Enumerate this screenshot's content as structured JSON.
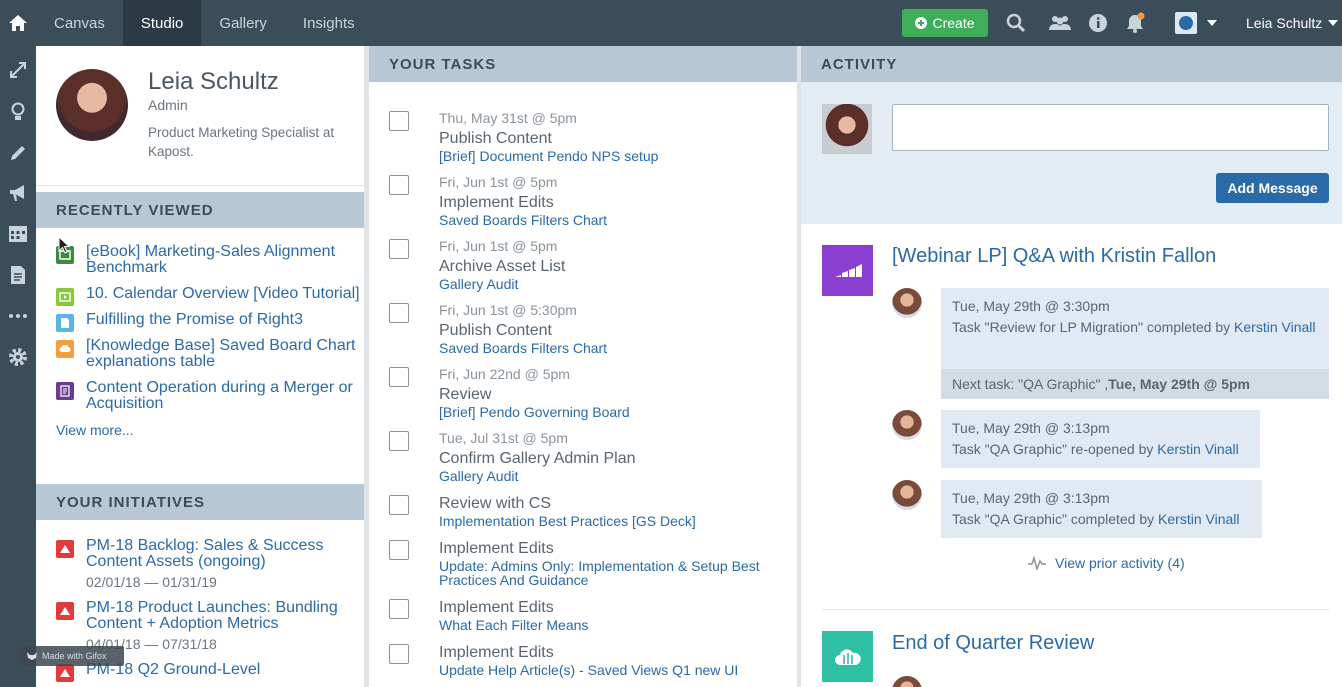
{
  "nav": {
    "tabs": [
      {
        "label": "Canvas"
      },
      {
        "label": "Studio"
      },
      {
        "label": "Gallery"
      },
      {
        "label": "Insights"
      }
    ],
    "create_label": "Create",
    "user_name": "Leia Schultz"
  },
  "profile": {
    "name": "Leia Schultz",
    "role": "Admin",
    "description": "Product Marketing Specialist at Kapost."
  },
  "recently_viewed": {
    "heading": "RECENTLY VIEWED",
    "items": [
      {
        "label": "[eBook] Marketing-Sales Alignment Benchmark",
        "color": "#3d8b3d"
      },
      {
        "label": "10. Calendar Overview [Video Tutorial]",
        "color": "#8cc63f"
      },
      {
        "label": "Fulfilling the Promise of Right3",
        "color": "#5bb5e0"
      },
      {
        "label": "[Knowledge Base] Saved Board Chart explanations table",
        "color": "#f0a040"
      },
      {
        "label": "Content Operation during a Merger or Acquisition",
        "color": "#6a3d8e"
      }
    ],
    "view_more": "View more..."
  },
  "initiatives": {
    "heading": "YOUR INITIATIVES",
    "items": [
      {
        "title": "PM-18 Backlog: Sales & Success Content Assets (ongoing)",
        "dates": "02/01/18 — 01/31/19"
      },
      {
        "title": "PM-18 Product Launches: Bundling Content + Adoption Metrics",
        "dates": "04/01/18 — 07/31/18"
      },
      {
        "title": "PM-18 Q2 Ground-Level",
        "dates": ""
      }
    ]
  },
  "tasks": {
    "heading": "YOUR TASKS",
    "items": [
      {
        "date": "Thu, May 31st @ 5pm",
        "title": "Publish Content",
        "link": "[Brief] Document Pendo NPS setup"
      },
      {
        "date": "Fri, Jun 1st @ 5pm",
        "title": "Implement Edits",
        "link": "Saved Boards Filters Chart"
      },
      {
        "date": "Fri, Jun 1st @ 5pm",
        "title": "Archive Asset List",
        "link": "Gallery Audit"
      },
      {
        "date": "Fri, Jun 1st @ 5:30pm",
        "title": "Publish Content",
        "link": "Saved Boards Filters Chart"
      },
      {
        "date": "Fri, Jun 22nd @ 5pm",
        "title": "Review",
        "link": "[Brief] Pendo Governing Board"
      },
      {
        "date": "Tue, Jul 31st @ 5pm",
        "title": "Confirm Gallery Admin Plan",
        "link": "Gallery Audit"
      },
      {
        "date": "",
        "title": "Review with CS",
        "link": "Implementation Best Practices [GS Deck]"
      },
      {
        "date": "",
        "title": "Implement Edits",
        "link": "Update: Admins Only: Implementation & Setup Best Practices And Guidance"
      },
      {
        "date": "",
        "title": "Implement Edits",
        "link": "What Each Filter Means"
      },
      {
        "date": "",
        "title": "Implement Edits",
        "link": "Update Help Article(s) - Saved Views Q1 new UI"
      }
    ]
  },
  "activity": {
    "heading": "ACTIVITY",
    "add_message": "Add Message",
    "feed1": {
      "title": "[Webinar LP] Q&A with Kristin Fallon",
      "entries": [
        {
          "time": "Tue, May 29th @ 3:30pm",
          "text": "Task \"Review for LP Migration\" completed by ",
          "person": "Kerstin Vinall"
        },
        {
          "time": "Tue, May 29th @ 3:13pm",
          "text": "Task \"QA Graphic\" re-opened by ",
          "person": "Kerstin Vinall"
        },
        {
          "time": "Tue, May 29th @ 3:13pm",
          "text": "Task \"QA Graphic\" completed by ",
          "person": "Kerstin Vinall"
        }
      ],
      "next_task_label": "Next task: \"QA Graphic\" , ",
      "next_task_date": "Tue, May 29th @ 5pm",
      "prior": "View prior activity (4)"
    },
    "feed2": {
      "title": "End of Quarter Review"
    }
  },
  "watermark": "Made with Gifox",
  "colors": {
    "nav": "#3c4d5a",
    "accent": "#2a6aa8",
    "create": "#3fae5a",
    "section": "#b8c8d6"
  }
}
